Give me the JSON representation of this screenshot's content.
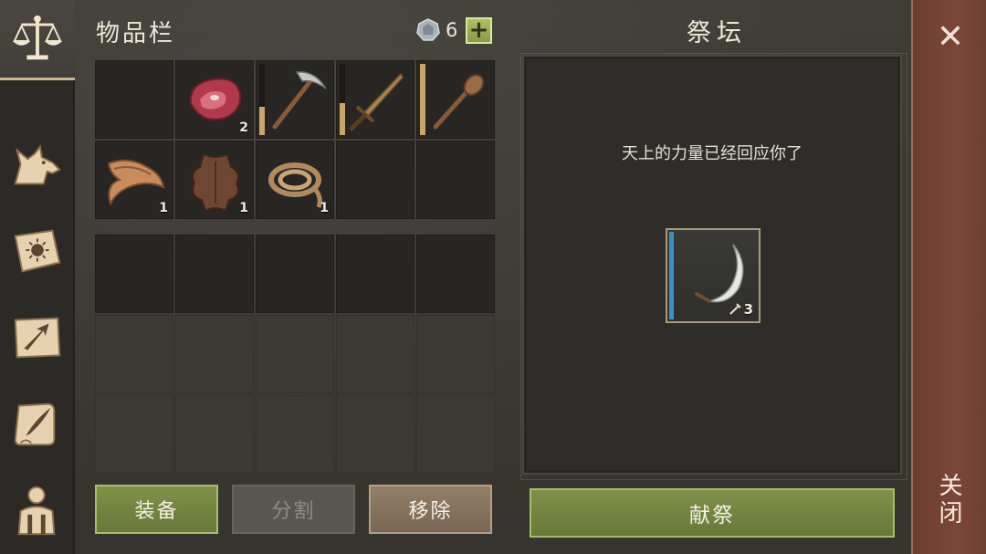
{
  "sidebar": {
    "tabs": [
      {
        "icon": "scales-icon",
        "active": true
      },
      {
        "icon": "wolf-icon",
        "active": false
      },
      {
        "icon": "sun-book-icon",
        "active": false
      },
      {
        "icon": "map-arrow-icon",
        "active": false
      },
      {
        "icon": "scroll-quill-icon",
        "active": false
      },
      {
        "icon": "backpack-person-icon",
        "active": false
      }
    ]
  },
  "inventory": {
    "title": "物品栏",
    "coins": "6",
    "add_label": "+",
    "top_grid": [
      {
        "item": "empty"
      },
      {
        "item": "raw-meat-icon",
        "qty": "2"
      },
      {
        "item": "pickaxe-icon",
        "durability": 0.4
      },
      {
        "item": "sword-icon",
        "durability": 0.45
      },
      {
        "item": "club-icon",
        "durability": 1.0
      },
      {
        "item": "cloth-icon",
        "qty": "1"
      },
      {
        "item": "hide-icon",
        "qty": "1"
      },
      {
        "item": "rope-icon",
        "qty": "1"
      },
      {
        "item": "empty"
      },
      {
        "item": "empty"
      }
    ],
    "buttons": {
      "equip": "装备",
      "split": "分割",
      "remove": "移除"
    }
  },
  "altar": {
    "title": "祭坛",
    "message": "天上的力量已经回应你了",
    "reward": {
      "item": "sickle-icon",
      "qty": "3"
    },
    "sacrifice_label": "献祭"
  },
  "close": {
    "label": "关闭"
  },
  "colors": {
    "accent_green": "#7f9148",
    "close_red": "#7b4638",
    "durability": "#c9a56a",
    "rarity_blue": "#3d8fc4"
  }
}
